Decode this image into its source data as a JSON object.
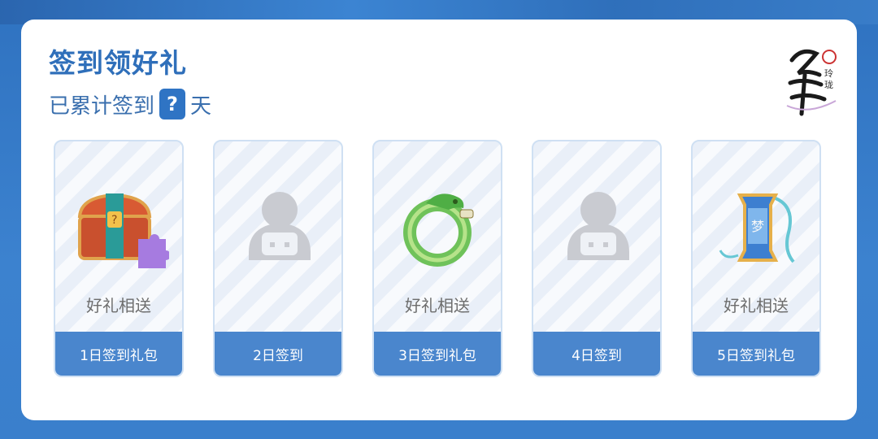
{
  "header": {
    "title": "签到领好礼",
    "subtitle_prefix": "已累计签到",
    "days_count": "?",
    "subtitle_suffix": "天",
    "logo_text": "浮生 忆玲珑"
  },
  "cards": [
    {
      "gift_text": "好礼相送",
      "footer_label": "1日签到礼包",
      "image_icon": "treasure-chest-icon"
    },
    {
      "gift_text": "",
      "footer_label": "2日签到",
      "image_icon": "placeholder-avatar-icon"
    },
    {
      "gift_text": "好礼相送",
      "footer_label": "3日签到礼包",
      "image_icon": "jade-dragon-ring-icon"
    },
    {
      "gift_text": "",
      "footer_label": "4日签到",
      "image_icon": "placeholder-avatar-icon"
    },
    {
      "gift_text": "好礼相送",
      "footer_label": "5日签到礼包",
      "image_icon": "dream-scroll-pendant-icon"
    }
  ],
  "colors": {
    "accent": "#2f74c4",
    "footer": "#4a86cd",
    "background": "#3a7fcc"
  }
}
